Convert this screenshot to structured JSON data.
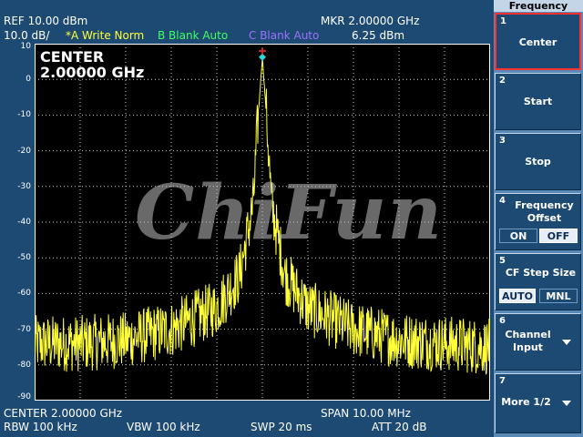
{
  "header": {
    "ref": "REF  10.00 dBm",
    "scale": "10.0 dB/",
    "trace_a": "*A Write Norm",
    "trace_b": "B Blank Auto",
    "trace_c": "C Blank Auto",
    "marker_freq": "MKR 2.00000 GHz",
    "marker_level": "6.25 dBm"
  },
  "colors": {
    "trace_a": "#ffff3a",
    "trace_b": "#40ff60",
    "trace_c": "#a070ff",
    "marker": "#30d8d8",
    "peak": "#ff3030"
  },
  "readout": {
    "title": "CENTER",
    "value": "2.00000 GHz"
  },
  "watermark": "ChiFun",
  "footer": {
    "center": "CENTER 2.00000 GHz",
    "span": "SPAN 10.00 MHz",
    "rbw": "RBW  100 kHz",
    "vbw": "VBW  100 kHz",
    "swp": "SWP  20 ms",
    "att": "ATT  20 dB"
  },
  "softkeys": {
    "menu_title": "Frequency",
    "keys": [
      {
        "num": "1",
        "label": "Center"
      },
      {
        "num": "2",
        "label": "Start"
      },
      {
        "num": "3",
        "label": "Stop"
      },
      {
        "num": "4",
        "label": "Frequency Offset",
        "option_a": "ON",
        "option_b": "OFF",
        "selected": "OFF"
      },
      {
        "num": "5",
        "label": "CF Step Size",
        "option_a": "AUTO",
        "option_b": "MNL",
        "selected": "AUTO"
      },
      {
        "num": "6",
        "label": "Channel Input"
      },
      {
        "num": "7",
        "label": "More 1/2"
      }
    ]
  },
  "chart_data": {
    "type": "line",
    "title": "",
    "xlabel": "",
    "ylabel": "",
    "x_unit": "GHz",
    "y_unit": "dBm",
    "xlim": [
      1.995,
      2.005
    ],
    "ylim": [
      -90,
      10
    ],
    "y_ticks": [
      10,
      0,
      -10,
      -20,
      -30,
      -40,
      -50,
      -60,
      -70,
      -80,
      -90
    ],
    "grid": true,
    "series": [
      {
        "name": "A",
        "x": [
          1.995,
          1.996,
          1.997,
          1.998,
          1.999,
          1.9995,
          1.9998,
          1.9999,
          2.0,
          2.0001,
          2.0002,
          2.0005,
          2.001,
          2.002,
          2.003,
          2.004,
          2.005
        ],
        "y": [
          -74,
          -74,
          -73,
          -70,
          -64,
          -55,
          -35,
          -12,
          6.25,
          -12,
          -35,
          -55,
          -64,
          -70,
          -73,
          -74,
          -75
        ]
      }
    ],
    "noise_band_db": 8,
    "marker": {
      "x": 2.0,
      "y": 6.25
    }
  }
}
